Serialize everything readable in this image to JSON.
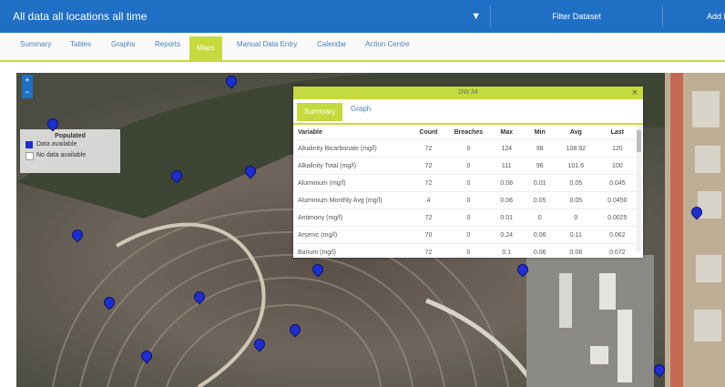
{
  "header": {
    "dataset_label": "All data all locations all time",
    "filter_label": "Filter Dataset",
    "add_label": "Add D"
  },
  "tabs": [
    {
      "label": "Summary"
    },
    {
      "label": "Tables"
    },
    {
      "label": "Graphs"
    },
    {
      "label": "Reports"
    },
    {
      "label": "Maps"
    },
    {
      "label": "Manual Data Entry"
    },
    {
      "label": "Calendar"
    },
    {
      "label": "Action Centre"
    }
  ],
  "map": {
    "zoom_in": "+",
    "zoom_out": "−",
    "legend": {
      "title": "Populated",
      "items": [
        {
          "label": "Data available",
          "color": "#1d2fd0"
        },
        {
          "label": "No data available",
          "color": "#ffffff"
        }
      ]
    }
  },
  "popup": {
    "title": "DW 34",
    "close": "×",
    "tabs": [
      {
        "label": "Summary"
      },
      {
        "label": "Graph"
      }
    ],
    "columns": [
      "Variable",
      "Count",
      "Breaches",
      "Max",
      "Min",
      "Avg",
      "Last"
    ],
    "rows": [
      [
        "Alkalinity Bicarbonate (mg/l)",
        "72",
        "0",
        "124",
        "98",
        "108.92",
        "120"
      ],
      [
        "Alkalinity Total (mg/l)",
        "72",
        "0",
        "111",
        "96",
        "101.6",
        "100"
      ],
      [
        "Aluminium (mg/l)",
        "72",
        "0",
        "0.08",
        "0.01",
        "0.05",
        "0.045"
      ],
      [
        "Aluminium Monthly Avg (mg/l)",
        "4",
        "0",
        "0.06",
        "0.05",
        "0.05",
        "0.0450"
      ],
      [
        "Antimony (mg/l)",
        "72",
        "0",
        "0.01",
        "0",
        "0",
        "0.0025"
      ],
      [
        "Arsenic (mg/l)",
        "70",
        "0",
        "0.24",
        "0.06",
        "0.11",
        "0.062"
      ],
      [
        "Barium (mg/l)",
        "72",
        "0",
        "0.1",
        "0.06",
        "0.08",
        "0.072"
      ]
    ]
  },
  "colors": {
    "brand": "#1f6fc4",
    "accent": "#c5da3c",
    "pin": "#1d2fd0"
  }
}
